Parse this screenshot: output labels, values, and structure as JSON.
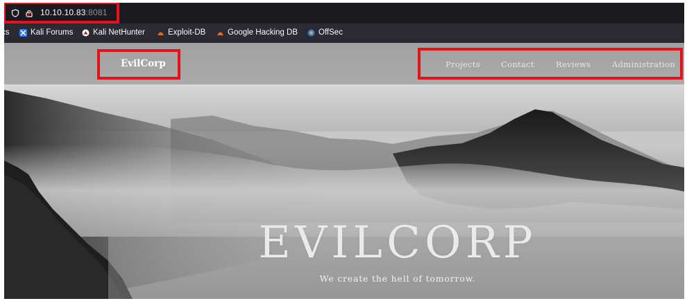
{
  "browser": {
    "url_host": "10.10.10.83",
    "url_port": ":8081"
  },
  "bookmarks": [
    {
      "label": "cs",
      "icon": "truncated"
    },
    {
      "label": "Kali Forums",
      "icon": "kali-forums-icon"
    },
    {
      "label": "Kali NetHunter",
      "icon": "kali-nethunter-icon"
    },
    {
      "label": "Exploit-DB",
      "icon": "exploit-db-icon"
    },
    {
      "label": "Google Hacking DB",
      "icon": "ghdb-icon"
    },
    {
      "label": "OffSec",
      "icon": "offsec-icon"
    }
  ],
  "site": {
    "brand": "EvilCorp",
    "nav": [
      "Projects",
      "Contact",
      "Reviews",
      "Administration"
    ],
    "hero_title": "EVILCORP",
    "hero_subtitle": "We create the hell of tomorrow."
  },
  "colors": {
    "highlight": "#e8101a",
    "toolbar": "#1b1b1f",
    "bookmarks_bar": "#2b2a33"
  }
}
